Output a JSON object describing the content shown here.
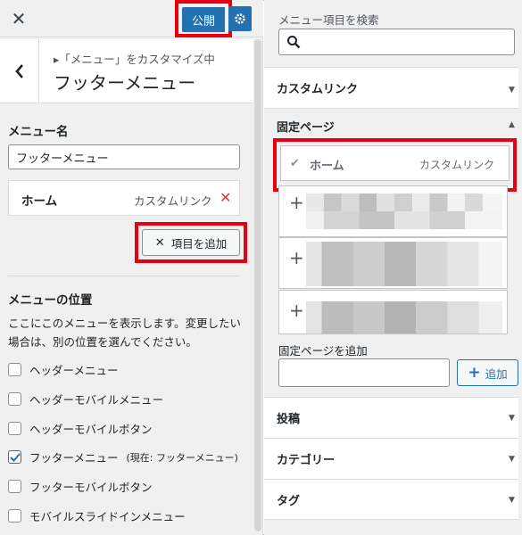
{
  "header": {
    "close_icon": "close-icon",
    "publish_label": "公開",
    "settings_icon": "gear-icon",
    "back_icon": "chevron-left-icon",
    "breadcrumb": "▸「メニュー」をカスタマイズ中",
    "title": "フッターメニュー"
  },
  "menu": {
    "name_label": "メニュー名",
    "name_value": "フッターメニュー",
    "items": [
      {
        "title": "ホーム",
        "type": "カスタムリンク"
      }
    ],
    "add_item_label": "項目を追加"
  },
  "locations": {
    "heading": "メニューの位置",
    "description": "ここにこのメニューを表示します。変更したい場合は、別の位置を選んでください。",
    "options": [
      {
        "label": "ヘッダーメニュー",
        "checked": false
      },
      {
        "label": "ヘッダーモバイルメニュー",
        "checked": false
      },
      {
        "label": "ヘッダーモバイルボタン",
        "checked": false
      },
      {
        "label": "フッターメニュー",
        "note": "(現在: フッターメニュー)",
        "checked": true
      },
      {
        "label": "フッターモバイルボタン",
        "checked": false
      },
      {
        "label": "モバイルスライドインメニュー",
        "checked": false
      }
    ]
  },
  "add_panel": {
    "search_label": "メニュー項目を検索",
    "search_value": "",
    "sections": {
      "custom_link": "カスタムリンク",
      "pages": "固定ページ",
      "posts": "投稿",
      "categories": "カテゴリー",
      "tags": "タグ"
    },
    "home_item": {
      "title": "ホーム",
      "type": "カスタムリンク"
    },
    "add_page_label": "固定ページを追加",
    "add_page_button": "追加"
  },
  "colors": {
    "accent": "#2271b1",
    "highlight": "#e60012",
    "delete": "#d63638"
  }
}
